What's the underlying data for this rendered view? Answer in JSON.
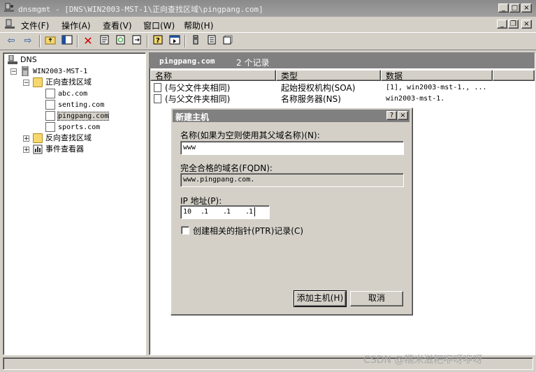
{
  "window": {
    "title": "dnsmgmt - [DNS\\WIN2003-MST-1\\正向查找区域\\pingpang.com]",
    "buttons": {
      "minimize": "_",
      "maximize": "□",
      "close": "×"
    }
  },
  "menu": {
    "items": [
      "文件(F)",
      "操作(A)",
      "查看(V)",
      "窗口(W)",
      "帮助(H)"
    ],
    "mdi_buttons": {
      "minimize": "_",
      "restore": "❐",
      "close": "×"
    }
  },
  "toolbar": {
    "icons": [
      "back-icon",
      "forward-icon",
      "up-folder-icon",
      "show-hide-tree-icon",
      "delete-icon",
      "properties-icon",
      "refresh-icon",
      "export-icon",
      "help-icon",
      "console-icon",
      "host-icon",
      "record-icon",
      "new-record-icon"
    ]
  },
  "tree": {
    "root": "DNS",
    "server": "WIN2003-MST-1",
    "forward_zones": "正向查找区域",
    "zones": [
      "abc.com",
      "senting.com",
      "pingpang.com",
      "sports.com"
    ],
    "selected_zone": "pingpang.com",
    "reverse_zones": "反向查找区域",
    "event_viewer": "事件查看器"
  },
  "list": {
    "zone_name": "pingpang.com",
    "record_count": "2 个记录",
    "columns": [
      "名称",
      "类型",
      "数据"
    ],
    "rows": [
      {
        "name": "(与父文件夹相同)",
        "type": "起始授权机构(SOA)",
        "data": "[1], win2003-mst-1., ..."
      },
      {
        "name": "(与父文件夹相同)",
        "type": "名称服务器(NS)",
        "data": "win2003-mst-1."
      }
    ]
  },
  "dialog": {
    "title": "新建主机",
    "help_button": "?",
    "close_button": "×",
    "name_label": "名称(如果为空则使用其父域名称)(N):",
    "name_value": "www",
    "fqdn_label": "完全合格的域名(FQDN):",
    "fqdn_value": "www.pingpang.com.",
    "ip_label": "IP 地址(P):",
    "ip_octets": [
      "10",
      "1",
      "1",
      "1"
    ],
    "ip_dots": [
      ".",
      ".",
      "."
    ],
    "ptr_checked": false,
    "ptr_label": "创建相关的指针(PTR)记录(C)",
    "add_button": "添加主机(H)",
    "cancel_button": "取消"
  },
  "watermark": "CSDN @糯米滋粑咿呀咿呀"
}
